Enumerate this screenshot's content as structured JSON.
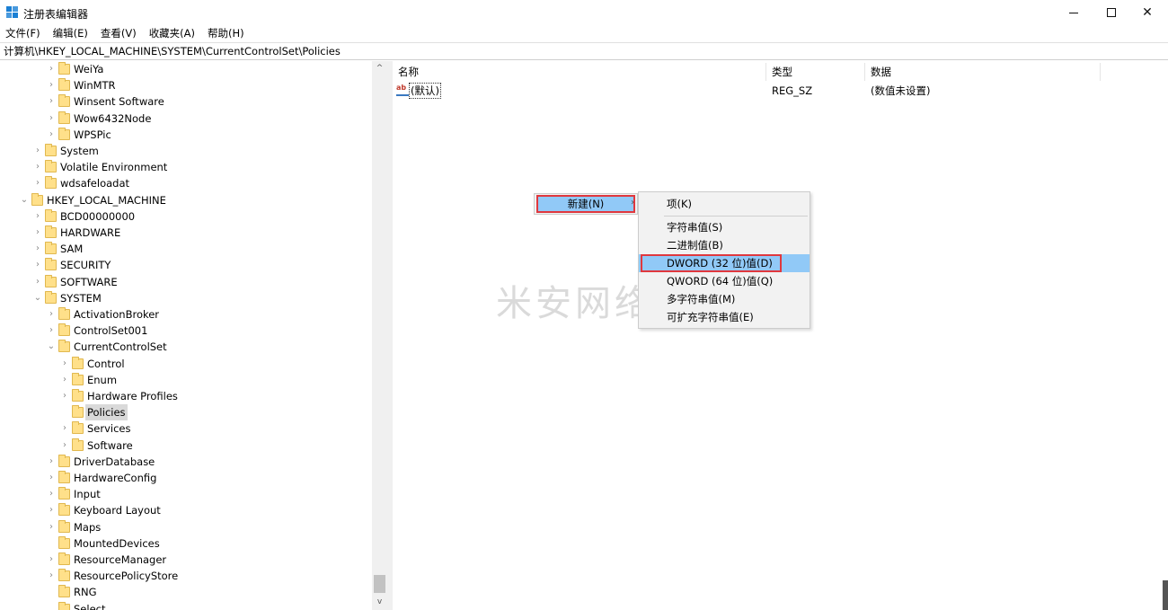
{
  "window": {
    "title": "注册表编辑器",
    "controls": {
      "minimize_icon": "minimize-icon",
      "maximize_icon": "maximize-icon",
      "close_icon": "close-icon",
      "close_glyph": "✕"
    }
  },
  "menu": [
    "文件(F)",
    "编辑(E)",
    "查看(V)",
    "收藏夹(A)",
    "帮助(H)"
  ],
  "address": "计算机\\HKEY_LOCAL_MACHINE\\SYSTEM\\CurrentControlSet\\Policies",
  "tree": [
    {
      "label": "WeiYa",
      "depth": 2,
      "chevron": "›"
    },
    {
      "label": "WinMTR",
      "depth": 2,
      "chevron": "›"
    },
    {
      "label": "Winsent Software",
      "depth": 2,
      "chevron": "›"
    },
    {
      "label": "Wow6432Node",
      "depth": 2,
      "chevron": "›"
    },
    {
      "label": "WPSPic",
      "depth": 2,
      "chevron": "›"
    },
    {
      "label": "System",
      "depth": 1,
      "chevron": "›"
    },
    {
      "label": "Volatile Environment",
      "depth": 1,
      "chevron": "›"
    },
    {
      "label": "wdsafeloadat",
      "depth": 1,
      "chevron": "›"
    },
    {
      "label": "HKEY_LOCAL_MACHINE",
      "depth": 0,
      "chevron": "⌄"
    },
    {
      "label": "BCD00000000",
      "depth": 1,
      "chevron": "›"
    },
    {
      "label": "HARDWARE",
      "depth": 1,
      "chevron": "›"
    },
    {
      "label": "SAM",
      "depth": 1,
      "chevron": "›"
    },
    {
      "label": "SECURITY",
      "depth": 1,
      "chevron": "›"
    },
    {
      "label": "SOFTWARE",
      "depth": 1,
      "chevron": "›"
    },
    {
      "label": "SYSTEM",
      "depth": 1,
      "chevron": "⌄"
    },
    {
      "label": "ActivationBroker",
      "depth": 2,
      "chevron": "›"
    },
    {
      "label": "ControlSet001",
      "depth": 2,
      "chevron": "›"
    },
    {
      "label": "CurrentControlSet",
      "depth": 2,
      "chevron": "⌄"
    },
    {
      "label": "Control",
      "depth": 3,
      "chevron": "›"
    },
    {
      "label": "Enum",
      "depth": 3,
      "chevron": "›"
    },
    {
      "label": "Hardware Profiles",
      "depth": 3,
      "chevron": "›"
    },
    {
      "label": "Policies",
      "depth": 3,
      "chevron": "",
      "selected": true
    },
    {
      "label": "Services",
      "depth": 3,
      "chevron": "›"
    },
    {
      "label": "Software",
      "depth": 3,
      "chevron": "›"
    },
    {
      "label": "DriverDatabase",
      "depth": 2,
      "chevron": "›"
    },
    {
      "label": "HardwareConfig",
      "depth": 2,
      "chevron": "›"
    },
    {
      "label": "Input",
      "depth": 2,
      "chevron": "›"
    },
    {
      "label": "Keyboard Layout",
      "depth": 2,
      "chevron": "›"
    },
    {
      "label": "Maps",
      "depth": 2,
      "chevron": "›"
    },
    {
      "label": "MountedDevices",
      "depth": 2,
      "chevron": ""
    },
    {
      "label": "ResourceManager",
      "depth": 2,
      "chevron": "›"
    },
    {
      "label": "ResourcePolicyStore",
      "depth": 2,
      "chevron": "›"
    },
    {
      "label": "RNG",
      "depth": 2,
      "chevron": ""
    },
    {
      "label": "Select",
      "depth": 2,
      "chevron": ""
    }
  ],
  "list": {
    "columns": [
      "名称",
      "类型",
      "数据"
    ],
    "rows": [
      {
        "name": "(默认)",
        "type": "REG_SZ",
        "data": "(数值未设置)",
        "icon": "string-value-icon",
        "icon_text": "ab"
      }
    ]
  },
  "context_menu": {
    "new_label": "新建(N)",
    "submenu": [
      "项(K)",
      "字符串值(S)",
      "二进制值(B)",
      "DWORD (32 位)值(D)",
      "QWORD (64 位)值(Q)",
      "多字符串值(M)",
      "可扩充字符串值(E)"
    ],
    "highlighted": "DWORD (32 位)值(D)"
  },
  "watermark": "米安网络",
  "colors": {
    "highlight": "#91c9f7",
    "annotation_border": "#e0383e",
    "folder": "#ffe08a"
  }
}
